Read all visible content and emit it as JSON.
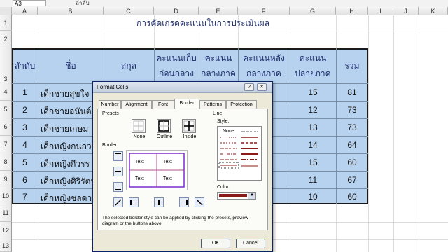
{
  "formula_bar": {
    "name_box": "A3",
    "formula": "ลำดับ"
  },
  "columns": [
    "A",
    "B",
    "C",
    "D",
    "E",
    "F",
    "G",
    "H",
    "I",
    "J",
    "K"
  ],
  "rows": [
    "1",
    "2",
    "3",
    "4",
    "5",
    "6",
    "7",
    "8",
    "9",
    "10",
    "11",
    "12",
    "13"
  ],
  "sheet": {
    "title": "การคัดเกรดคะแนนในการประเมินผล",
    "headers": [
      "ลำดับ",
      "ชื่อ",
      "สกุล",
      "คะแนนเก็บก่อนกลางภาค",
      "คะแนนกลางภาค",
      "คะแนนหลังกลางภาค",
      "คะแนนปลายภาค",
      "รวม"
    ],
    "rows": [
      {
        "no": "1",
        "name": "เด็กชายสุขใจ",
        "final": "15",
        "total": "81"
      },
      {
        "no": "2",
        "name": "เด็กชายอนันต์",
        "final": "12",
        "total": "73"
      },
      {
        "no": "3",
        "name": "เด็กชายเกษม",
        "final": "13",
        "total": "73"
      },
      {
        "no": "4",
        "name": "เด็กหญิงกนกวรร",
        "final": "14",
        "total": "64"
      },
      {
        "no": "5",
        "name": "เด็กหญิงกีวรร",
        "final": "15",
        "total": "60"
      },
      {
        "no": "6",
        "name": "เด็กหญิงศิริรัตน์",
        "final": "11",
        "total": "67"
      },
      {
        "no": "7",
        "name": "เด็กหญิงชลดา",
        "final": "10",
        "total": "60"
      }
    ]
  },
  "dialog": {
    "title": "Format Cells",
    "tabs": [
      "Number",
      "Alignment",
      "Font",
      "Border",
      "Patterns",
      "Protection"
    ],
    "active_tab": "Border",
    "presets_label": "Presets",
    "preset_buttons": [
      "None",
      "Outline",
      "Inside"
    ],
    "border_label": "Border",
    "preview_text": [
      "Text",
      "Text",
      "Text",
      "Text"
    ],
    "line_label": "Line",
    "style_label": "Style:",
    "style_none": "None",
    "color_label": "Color:",
    "line_color": "#8b1a1a",
    "hint": "The selected border style can be applied by clicking the presets, preview diagram or the buttons above.",
    "ok_label": "OK",
    "cancel_label": "Cancel"
  }
}
